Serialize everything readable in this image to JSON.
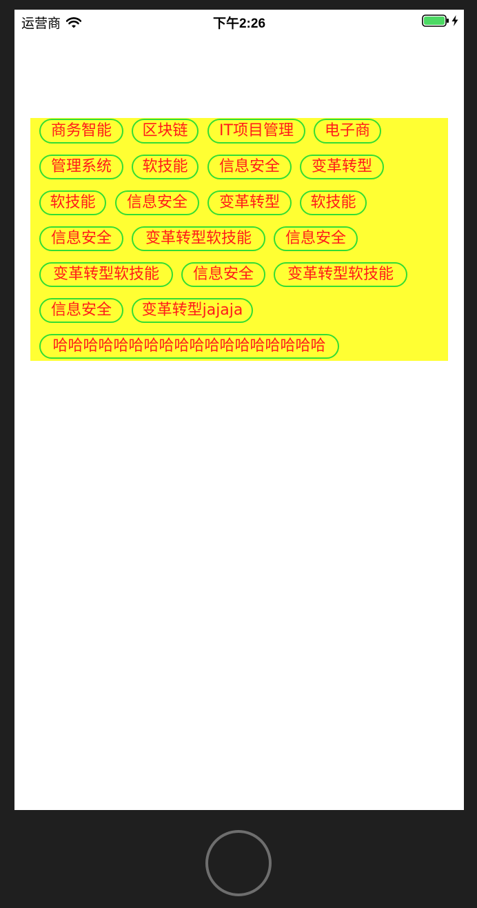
{
  "status_bar": {
    "carrier": "运营商",
    "time": "下午2:26",
    "battery_color": "#4cd964"
  },
  "tags": [
    "商务智能",
    "区块链",
    "IT项目管理",
    "电子商",
    "管理系统",
    "软技能",
    "信息安全",
    "变革转型",
    "软技能",
    "信息安全",
    "变革转型",
    "软技能",
    "信息安全",
    "变革转型软技能",
    "信息安全",
    "变革转型软技能",
    "信息安全",
    "变革转型软技能",
    "信息安全",
    "变革转型jajaja",
    "哈哈哈哈哈哈哈哈哈哈哈哈哈哈哈哈哈哈"
  ],
  "colors": {
    "panel_background": "#ffff33",
    "tag_border": "#33dd33",
    "tag_text": "#ff1a1a"
  }
}
